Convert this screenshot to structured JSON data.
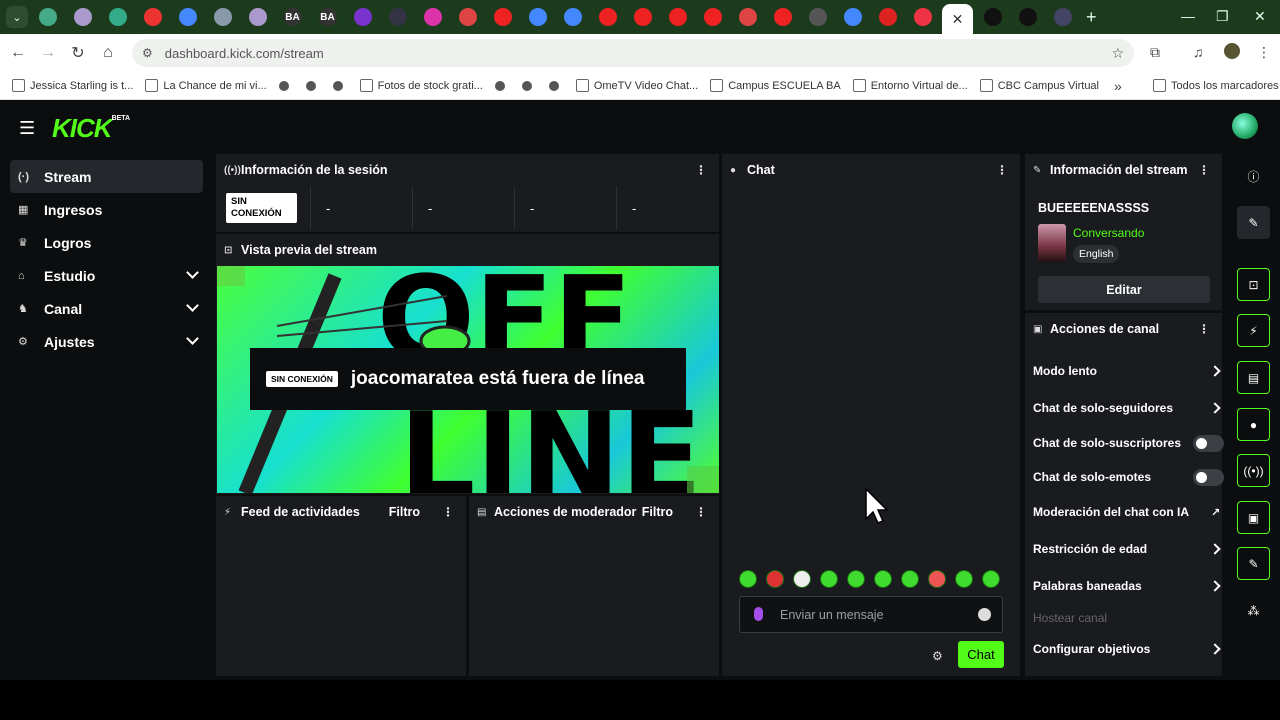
{
  "browser": {
    "url": "dashboard.kick.com/stream",
    "tabs": [
      {
        "icon": "chrome-icon",
        "color": "#4a8"
      },
      {
        "icon": "circle-icon",
        "color": "#a9c"
      },
      {
        "icon": "drive-icon",
        "color": "#3a8"
      },
      {
        "icon": "heart-icon",
        "color": "#e33"
      },
      {
        "icon": "google-icon",
        "color": "#48f"
      },
      {
        "icon": "people-icon",
        "color": "#89a"
      },
      {
        "icon": "circle-icon",
        "color": "#a9c"
      },
      {
        "icon": "ba-icon",
        "color": "#333",
        "text": "BA"
      },
      {
        "icon": "ba-icon",
        "color": "#333",
        "text": "BA"
      },
      {
        "icon": "list-icon",
        "color": "#73c"
      },
      {
        "icon": "square-icon",
        "color": "#334"
      },
      {
        "icon": "instagram-icon",
        "color": "#d3a"
      },
      {
        "icon": "gmail-icon",
        "color": "#d44"
      },
      {
        "icon": "youtube-icon",
        "color": "#e22"
      },
      {
        "icon": "google-icon",
        "color": "#48f"
      },
      {
        "icon": "google-icon",
        "color": "#48f"
      },
      {
        "icon": "youtube-icon",
        "color": "#e22"
      },
      {
        "icon": "youtube-icon",
        "color": "#e22"
      },
      {
        "icon": "youtube-icon",
        "color": "#e22"
      },
      {
        "icon": "youtube-icon",
        "color": "#e22"
      },
      {
        "icon": "gmail-icon",
        "color": "#d44"
      },
      {
        "icon": "youtube-icon",
        "color": "#e22"
      },
      {
        "icon": "figure-icon",
        "color": "#555"
      },
      {
        "icon": "google-icon",
        "color": "#48f"
      },
      {
        "icon": "red-square-icon",
        "color": "#d22"
      },
      {
        "icon": "record-icon",
        "color": "#e34"
      }
    ],
    "active_tab_icon": "close-icon",
    "after_tabs": [
      {
        "icon": "tiktok-icon",
        "color": "#111"
      },
      {
        "icon": "tiktok-icon",
        "color": "#111"
      },
      {
        "icon": "globe-icon",
        "color": "#446"
      }
    ],
    "bookmarks": [
      "Jessica Starling is t...",
      "La Chance de mi vi...",
      "",
      "",
      "",
      "Fotos de stock grati...",
      "",
      "",
      "",
      "OmeTV Video Chat...",
      "Campus ESCUELA BA",
      "Entorno Virtual de...",
      "CBC Campus Virtual"
    ],
    "all_bookmarks": "Todos los marcadores"
  },
  "app": {
    "logo": "KICK",
    "logo_sup": "BETA",
    "nav": [
      {
        "label": "Stream",
        "icon": "(·)",
        "expand": false,
        "active": true
      },
      {
        "label": "Ingresos",
        "icon": "▦",
        "expand": false,
        "active": false
      },
      {
        "label": "Logros",
        "icon": "♛",
        "expand": false,
        "active": false
      },
      {
        "label": "Estudio",
        "icon": "⌂",
        "expand": true,
        "active": false
      },
      {
        "label": "Canal",
        "icon": "♞",
        "expand": true,
        "active": false
      },
      {
        "label": "Ajustes",
        "icon": "⚙",
        "expand": true,
        "active": false
      }
    ],
    "session": {
      "title": "Información de la sesión",
      "status_badge": "SIN CONEXIÓN",
      "stats": [
        "-",
        "-",
        "-",
        "-"
      ]
    },
    "preview": {
      "title": "Vista previa del stream",
      "offline_badge": "SIN CONEXIÓN",
      "offline_text": "joacomaratea está fuera de línea"
    },
    "activity": {
      "title": "Feed de actividades",
      "filter": "Filtro"
    },
    "modactions": {
      "title": "Acciones de moderador",
      "filter": "Filtro"
    },
    "chat": {
      "title": "Chat",
      "placeholder": "Enviar un mensaje",
      "send": "Chat",
      "emotes": 10
    },
    "stream_info": {
      "title": "Información del stream",
      "name": "BUEEEEENASSSS",
      "category": "Conversando",
      "language": "English",
      "edit": "Editar"
    },
    "channel_actions": {
      "title": "Acciones de canal",
      "items": [
        {
          "label": "Modo lento",
          "control": "arrow"
        },
        {
          "label": "Chat de solo-seguidores",
          "control": "arrow"
        },
        {
          "label": "Chat de solo-suscriptores",
          "control": "toggle",
          "on": false
        },
        {
          "label": "Chat de solo-emotes",
          "control": "toggle",
          "on": false
        },
        {
          "label": "Moderación del chat con IA",
          "control": "external"
        },
        {
          "label": "Restricción de edad",
          "control": "arrow"
        },
        {
          "label": "Palabras baneadas",
          "control": "arrow"
        },
        {
          "label": "Hostear canal",
          "control": "none",
          "disabled": true
        },
        {
          "label": "Configurar objetivos",
          "control": "arrow"
        }
      ]
    },
    "colors": {
      "accent": "#53fc18",
      "panel": "#191b1f",
      "bg": "#0b0d0e"
    }
  }
}
